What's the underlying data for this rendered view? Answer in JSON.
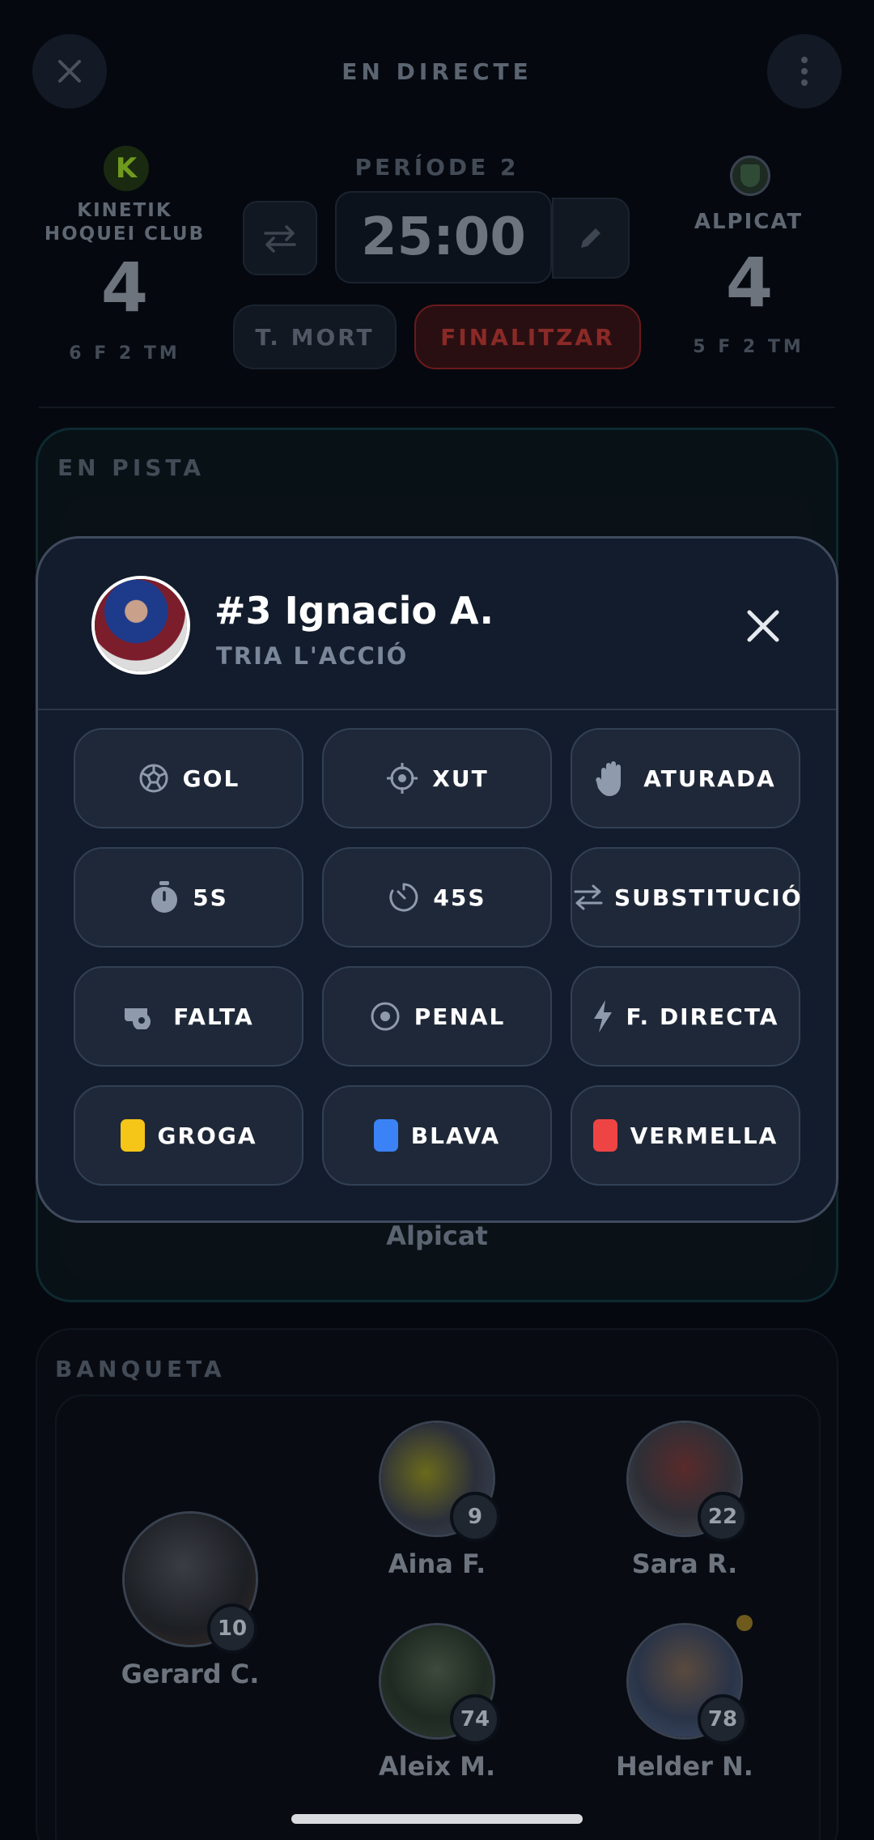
{
  "header": {
    "title": "EN DIRECTE",
    "close_icon": "close-icon",
    "menu_icon": "more-vertical-icon"
  },
  "home_team": {
    "name_line1": "KINETIK",
    "name_line2": "HOQUEI CLUB",
    "score": "4",
    "stats": "6 F   2 TM",
    "logo_letter": "K"
  },
  "away_team": {
    "name": "ALPICAT",
    "score": "4",
    "stats": "5 F   2 TM"
  },
  "clock": {
    "period": "PERÍODE 2",
    "time": "25:00",
    "timeout_label": "T. MORT",
    "finish_label": "FINALITZAR"
  },
  "on_court": {
    "label": "EN PISTA",
    "team_label": "Alpicat"
  },
  "bench": {
    "label": "BANQUETA",
    "players": [
      {
        "name": "Gerard C.",
        "number": "10"
      },
      {
        "name": "Aina F.",
        "number": "9"
      },
      {
        "name": "Sara R.",
        "number": "22"
      },
      {
        "name": "Aleix M.",
        "number": "74"
      },
      {
        "name": "Helder N.",
        "number": "78"
      }
    ]
  },
  "modal": {
    "player_title": "#3 Ignacio A.",
    "subtitle": "TRIA L'ACCIÓ",
    "actions": [
      {
        "label": "GOL",
        "icon": "ball-icon"
      },
      {
        "label": "XUT",
        "icon": "target-icon"
      },
      {
        "label": "ATURADA",
        "icon": "hand-icon"
      },
      {
        "label": "5S",
        "icon": "stopwatch-icon"
      },
      {
        "label": "45S",
        "icon": "timer-icon"
      },
      {
        "label": "SUBSTITUCIÓ",
        "icon": "swap-icon"
      },
      {
        "label": "FALTA",
        "icon": "whistle-icon"
      },
      {
        "label": "PENAL",
        "icon": "penalty-spot-icon"
      },
      {
        "label": "F. DIRECTA",
        "icon": "lightning-icon"
      },
      {
        "label": "GROGA",
        "icon": "yellow-card-icon",
        "color": "#f5c518"
      },
      {
        "label": "BLAVA",
        "icon": "blue-card-icon",
        "color": "#3b82f6"
      },
      {
        "label": "VERMELLA",
        "icon": "red-card-icon",
        "color": "#ef4444"
      }
    ]
  },
  "colors": {
    "background": "#05090f",
    "modal_bg": "#131c2c",
    "finish_red": "#e0463f",
    "court_teal": "#0f2f36",
    "notification_dot": "#c9a227"
  }
}
